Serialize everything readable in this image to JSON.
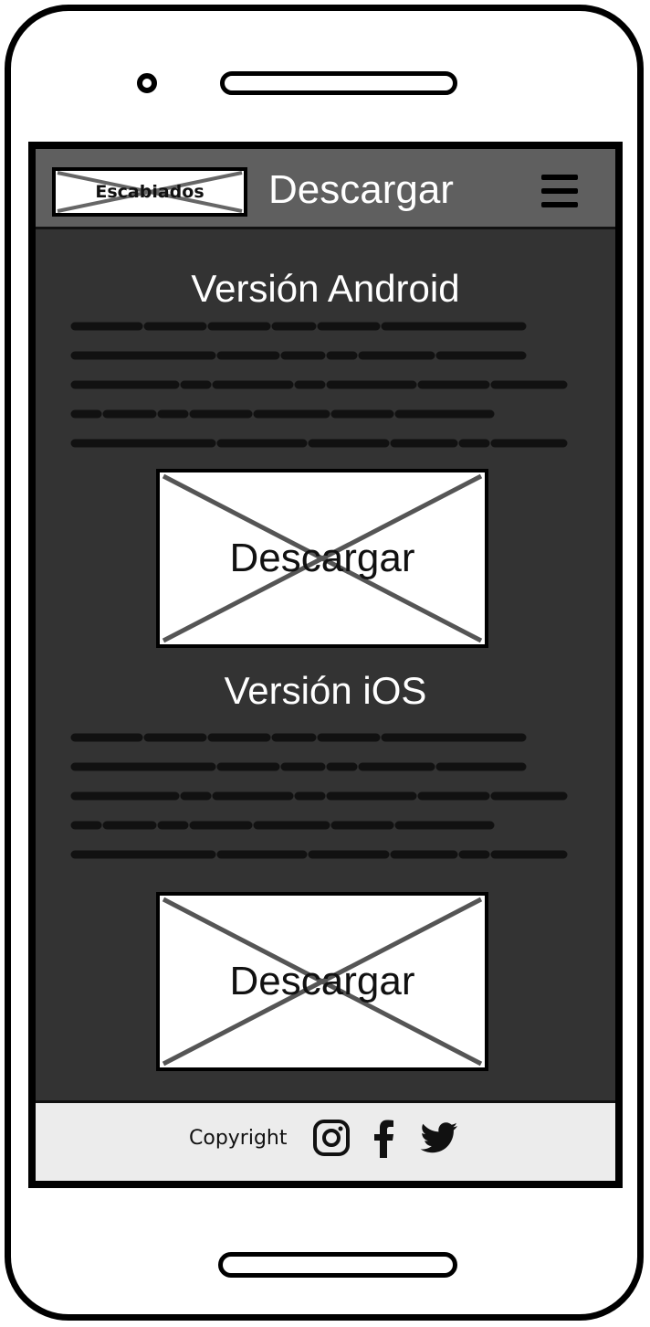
{
  "header": {
    "logo_text": "Escabiados",
    "title": "Descargar",
    "menu_icon": "hamburger-menu-icon"
  },
  "sections": [
    {
      "title": "Versión Android",
      "button_label": "Descargar"
    },
    {
      "title": "Versión iOS",
      "button_label": "Descargar"
    }
  ],
  "footer": {
    "copyright": "Copyright",
    "social_icons": [
      "instagram-icon",
      "facebook-icon",
      "twitter-icon"
    ]
  },
  "colors": {
    "screen_bg": "#333333",
    "header_bg": "#5f5f5f",
    "footer_bg": "#ececec",
    "placeholder_cross": "#555555"
  }
}
